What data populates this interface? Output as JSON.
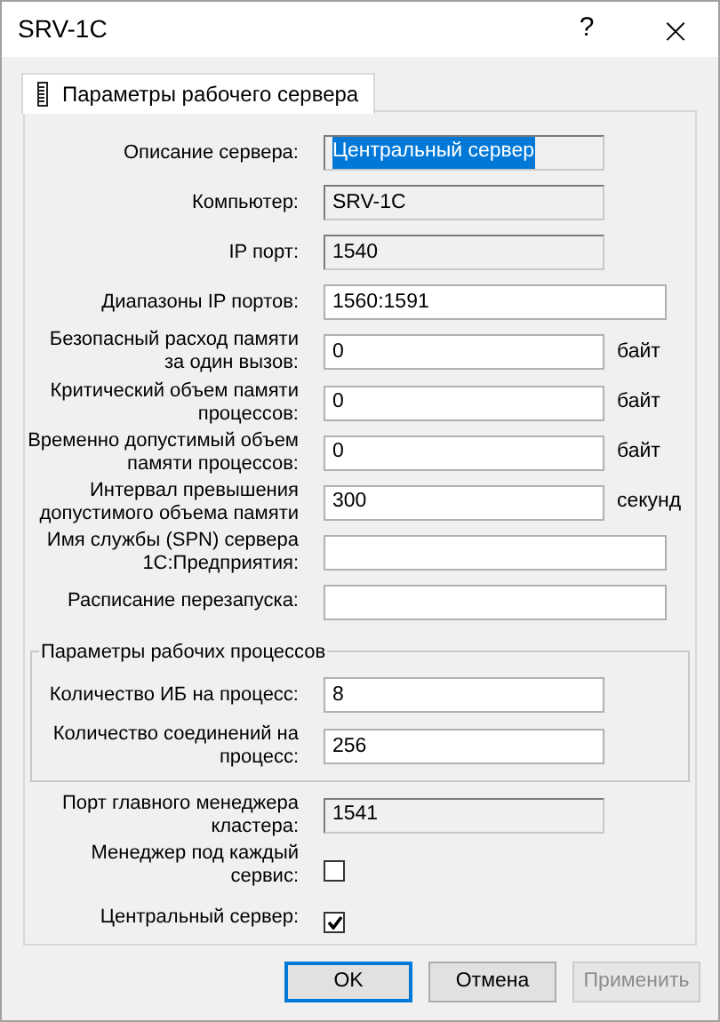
{
  "window": {
    "title": "SRV-1C",
    "help": "?",
    "close": "×"
  },
  "tabs": [
    {
      "label": "Параметры рабочего сервера",
      "selected": true
    }
  ],
  "fields": [
    {
      "kind": "readonly",
      "label": "Описание сервера:",
      "value": "Центральный сервер",
      "text_selected": true
    },
    {
      "kind": "readonly",
      "label": "Компьютер:",
      "value": "SRV-1C"
    },
    {
      "kind": "readonly",
      "label": "IP порт:",
      "value": "1540"
    },
    {
      "kind": "text",
      "label": "Диапазоны IP портов:",
      "value": "1560:1591"
    },
    {
      "kind": "text",
      "label": "Безопасный расход памяти за один вызов:",
      "value": "0",
      "unit": "байт"
    },
    {
      "kind": "text",
      "label": "Критический объем памяти процессов:",
      "value": "0",
      "unit": "байт"
    },
    {
      "kind": "text",
      "label": "Временно допустимый объем памяти процессов:",
      "value": "0",
      "unit": "байт"
    },
    {
      "kind": "text",
      "label": "Интервал превышения допустимого объема памяти",
      "value": "300",
      "unit": "секунд"
    },
    {
      "kind": "text",
      "label": "Имя службы (SPN) сервера 1С:Предприятия:"
    },
    {
      "kind": "text",
      "label": "Расписание перезапуска:"
    }
  ],
  "group": {
    "title": "Параметры рабочих процессов",
    "fields": [
      {
        "kind": "text",
        "label": "Количество ИБ на процесс:",
        "value": "8"
      },
      {
        "kind": "text",
        "label": "Количество соединений на процесс:",
        "value": "256"
      }
    ]
  },
  "after": [
    {
      "kind": "readonly",
      "label": "Порт главного менеджера кластера:",
      "value": "1541"
    },
    {
      "kind": "checkbox",
      "label": "Менеджер под каждый сервис:",
      "checked": false
    },
    {
      "kind": "checkbox",
      "label": "Центральный сервер:",
      "checked": true
    }
  ],
  "buttons": [
    {
      "label": "OK",
      "focused": true,
      "disabled": false
    },
    {
      "label": "Отмена",
      "focused": false,
      "disabled": false
    },
    {
      "label": "Применить",
      "focused": false,
      "disabled": true
    }
  ]
}
